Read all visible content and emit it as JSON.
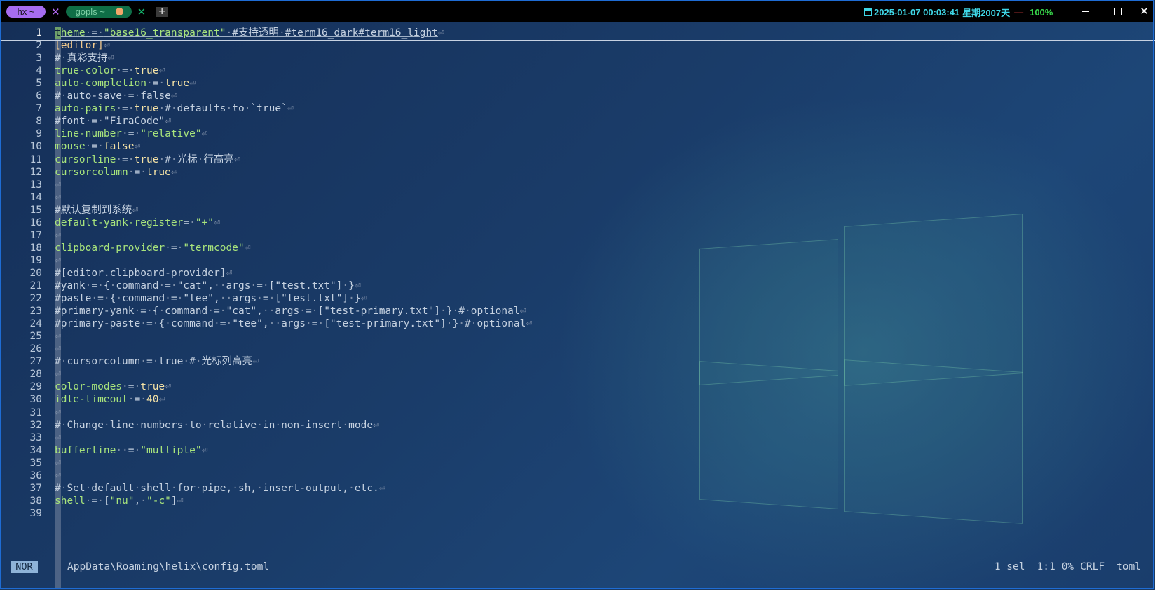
{
  "tabs": [
    {
      "label": "hx ~",
      "close": "✕",
      "color": "#a66cf0"
    },
    {
      "label": "gopls ~",
      "close": "✕",
      "color": "#0f6e47"
    }
  ],
  "new_tab_label": "+",
  "status": {
    "datetime": "2025-01-07 00:03:41",
    "weekday": "星期2",
    "day": "007天",
    "battery": "100%"
  },
  "editor": {
    "lines": [
      {
        "n": "1",
        "html": "<span class='cursor-block'>t</span><span class='ul'><span class='k'>heme</span><span class='ws'>·</span>=<span class='ws'>·</span><span class='s'>\"base16_transparent\"</span><span class='ws'>·</span>#支持透明<span class='ws'>·</span>#term16_dark#term16_light</span><span class='eol'>⏎</span>",
        "cur": true
      },
      {
        "n": "2",
        "html": "<span class='sec'>[editor]</span><span class='eol'>⏎</span>"
      },
      {
        "n": "3",
        "html": "<span class='c'>#<span class='ws'>·</span>真彩支持</span><span class='eol'>⏎</span>"
      },
      {
        "n": "4",
        "html": "<span class='k'>true-color</span><span class='ws'>·</span>=<span class='ws'>·</span><span class='b'>true</span><span class='eol'>⏎</span>"
      },
      {
        "n": "5",
        "html": "<span class='k'>auto-completion</span><span class='ws'>·</span>=<span class='ws'>·</span><span class='b'>true</span><span class='eol'>⏎</span>"
      },
      {
        "n": "6",
        "html": "<span class='c'>#<span class='ws'>·</span>auto-save<span class='ws'>·</span>=<span class='ws'>·</span>false</span><span class='eol'>⏎</span>"
      },
      {
        "n": "7",
        "html": "<span class='k'>auto-pairs</span><span class='ws'>·</span>=<span class='ws'>·</span><span class='b'>true</span><span class='ws'>·</span><span class='c'>#<span class='ws'>·</span>defaults<span class='ws'>·</span>to<span class='ws'>·</span>`true`</span><span class='eol'>⏎</span>"
      },
      {
        "n": "8",
        "html": "<span class='c'>#font<span class='ws'>·</span>=<span class='ws'>·</span>\"FiraCode\"</span><span class='eol'>⏎</span>"
      },
      {
        "n": "9",
        "html": "<span class='k'>line-number</span><span class='ws'>·</span>=<span class='ws'>·</span><span class='s'>\"relative\"</span><span class='eol'>⏎</span>"
      },
      {
        "n": "10",
        "html": "<span class='k'>mouse</span><span class='ws'>·</span>=<span class='ws'>·</span><span class='b'>false</span><span class='eol'>⏎</span>"
      },
      {
        "n": "11",
        "html": "<span class='k'>cursorline</span><span class='ws'>·</span>=<span class='ws'>·</span><span class='b'>true</span><span class='ws'>·</span><span class='c'>#<span class='ws'>·</span>光标<span class='ws'>·</span>行高亮</span><span class='eol'>⏎</span>"
      },
      {
        "n": "12",
        "html": "<span class='k'>cursorcolumn</span><span class='ws'>·</span>=<span class='ws'>·</span><span class='b'>true</span><span class='eol'>⏎</span>"
      },
      {
        "n": "13",
        "html": "<span class='eol'>⏎</span>"
      },
      {
        "n": "14",
        "html": "<span class='eol'>⏎</span>"
      },
      {
        "n": "15",
        "html": "<span class='c'>#默认复制到系统</span><span class='eol'>⏎</span>"
      },
      {
        "n": "16",
        "html": "<span class='k'>default-yank-register</span>=<span class='ws'>·</span><span class='s'>\"+\"</span><span class='eol'>⏎</span>"
      },
      {
        "n": "17",
        "html": "<span class='eol'>⏎</span>"
      },
      {
        "n": "18",
        "html": "<span class='k'>clipboard-provider</span><span class='ws'>·</span>=<span class='ws'>·</span><span class='s'>\"termcode\"</span><span class='eol'>⏎</span>"
      },
      {
        "n": "19",
        "html": "<span class='eol'>⏎</span>"
      },
      {
        "n": "20",
        "html": "<span class='c'>#[editor.clipboard-provider]</span><span class='eol'>⏎</span>"
      },
      {
        "n": "21",
        "html": "<span class='c'>#yank<span class='ws'>·</span>=<span class='ws'>·</span>{<span class='ws'>·</span>command<span class='ws'>·</span>=<span class='ws'>·</span>\"cat\",<span class='ws'>··</span>args<span class='ws'>·</span>=<span class='ws'>·</span>[\"test.txt\"]<span class='ws'>·</span>}</span><span class='eol'>⏎</span>"
      },
      {
        "n": "22",
        "html": "<span class='c'>#paste<span class='ws'>·</span>=<span class='ws'>·</span>{<span class='ws'>·</span>command<span class='ws'>·</span>=<span class='ws'>·</span>\"tee\",<span class='ws'>··</span>args<span class='ws'>·</span>=<span class='ws'>·</span>[\"test.txt\"]<span class='ws'>·</span>}</span><span class='eol'>⏎</span>"
      },
      {
        "n": "23",
        "html": "<span class='c'>#primary-yank<span class='ws'>·</span>=<span class='ws'>·</span>{<span class='ws'>·</span>command<span class='ws'>·</span>=<span class='ws'>·</span>\"cat\",<span class='ws'>··</span>args<span class='ws'>·</span>=<span class='ws'>·</span>[\"test-primary.txt\"]<span class='ws'>·</span>}<span class='ws'>·</span>#<span class='ws'>·</span>optional</span><span class='eol'>⏎</span>"
      },
      {
        "n": "24",
        "html": "<span class='c'>#primary-paste<span class='ws'>·</span>=<span class='ws'>·</span>{<span class='ws'>·</span>command<span class='ws'>·</span>=<span class='ws'>·</span>\"tee\",<span class='ws'>··</span>args<span class='ws'>·</span>=<span class='ws'>·</span>[\"test-primary.txt\"]<span class='ws'>·</span>}<span class='ws'>·</span>#<span class='ws'>·</span>optional</span><span class='eol'>⏎</span>"
      },
      {
        "n": "25",
        "html": "<span class='eol'>⏎</span>"
      },
      {
        "n": "26",
        "html": "<span class='eol'>⏎</span>"
      },
      {
        "n": "27",
        "html": "<span class='c'>#<span class='ws'>·</span>cursorcolumn<span class='ws'>·</span>=<span class='ws'>·</span>true<span class='ws'>·</span>#<span class='ws'>·</span>光标列高亮</span><span class='eol'>⏎</span>"
      },
      {
        "n": "28",
        "html": "<span class='eol'>⏎</span>"
      },
      {
        "n": "29",
        "html": "<span class='k'>color-modes</span><span class='ws'>·</span>=<span class='ws'>·</span><span class='b'>true</span><span class='eol'>⏎</span>"
      },
      {
        "n": "30",
        "html": "<span class='k'>idle-timeout</span><span class='ws'>·</span>=<span class='ws'>·</span><span class='b'>40</span><span class='eol'>⏎</span>"
      },
      {
        "n": "31",
        "html": "<span class='eol'>⏎</span>"
      },
      {
        "n": "32",
        "html": "<span class='c'>#<span class='ws'>·</span>Change<span class='ws'>·</span>line<span class='ws'>·</span>numbers<span class='ws'>·</span>to<span class='ws'>·</span>relative<span class='ws'>·</span>in<span class='ws'>·</span>non-insert<span class='ws'>·</span>mode</span><span class='eol'>⏎</span>"
      },
      {
        "n": "33",
        "html": "<span class='eol'>⏎</span>"
      },
      {
        "n": "34",
        "html": "<span class='k'>bufferline</span><span class='ws'>··</span>=<span class='ws'>·</span><span class='s'>\"multiple\"</span><span class='eol'>⏎</span>"
      },
      {
        "n": "35",
        "html": "<span class='eol'>⏎</span>"
      },
      {
        "n": "36",
        "html": "<span class='eol'>⏎</span>"
      },
      {
        "n": "37",
        "html": "<span class='c'>#<span class='ws'>·</span>Set<span class='ws'>·</span>default<span class='ws'>·</span>shell<span class='ws'>·</span>for<span class='ws'>·</span>pipe,<span class='ws'>·</span>sh,<span class='ws'>·</span>insert-output,<span class='ws'>·</span>etc.</span><span class='eol'>⏎</span>"
      },
      {
        "n": "38",
        "html": "<span class='k'>shell</span><span class='ws'>·</span>=<span class='ws'>·</span>[<span class='s'>\"nu\"</span>,<span class='ws'>·</span><span class='s'>\"-c\"</span>]<span class='eol'>⏎</span>"
      },
      {
        "n": "39",
        "html": ""
      }
    ]
  },
  "statusline": {
    "mode": "NOR",
    "file": "AppData\\Roaming\\helix\\config.toml",
    "selections": "1 sel",
    "position": "1:1",
    "percent": "0%",
    "line_ending": "CRLF",
    "language": "toml"
  }
}
